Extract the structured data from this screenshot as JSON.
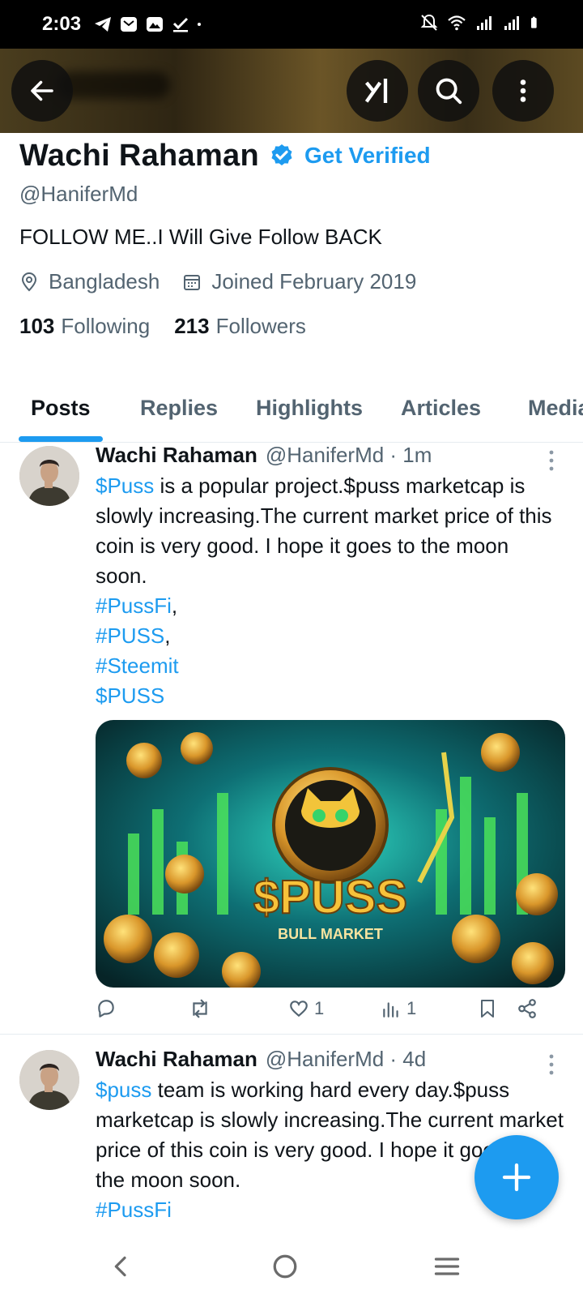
{
  "status_bar": {
    "time": "2:03",
    "left_icons": [
      "telegram-icon",
      "mail-icon",
      "gallery-icon",
      "task-icon",
      "dot-icon"
    ],
    "right_icons": [
      "mute-icon",
      "wifi-icon",
      "signal-icon",
      "signal-icon",
      "battery-icon"
    ]
  },
  "header": {
    "back_icon": "arrow-left-icon",
    "grok_icon": "grok-icon",
    "search_icon": "search-icon",
    "more_icon": "more-vertical-icon"
  },
  "profile": {
    "name": "Wachi Rahaman",
    "get_verified": "Get Verified",
    "handle": "@HaniferMd",
    "bio": "FOLLOW ME..I Will Give Follow BACK",
    "location": "Bangladesh",
    "joined": "Joined February 2019",
    "following_count": "103",
    "following_label": "Following",
    "followers_count": "213",
    "followers_label": "Followers"
  },
  "tabs": [
    {
      "label": "Posts",
      "active": true
    },
    {
      "label": "Replies"
    },
    {
      "label": "Highlights"
    },
    {
      "label": "Articles"
    },
    {
      "label": "Media"
    }
  ],
  "posts": [
    {
      "name": "Wachi Rahaman",
      "handle_time": "@HaniferMd · 1m",
      "cashtag": "$Puss",
      "text": " is a popular project.$puss marketcap is slowly increasing.The current market price of this coin is very good. I hope it goes to the moon soon.",
      "tag1": "#PussFi",
      "tag2": "#PUSS",
      "tag3": "#Steemit",
      "tag4": "$PUSS",
      "media_title": "$PUSS",
      "media_subtitle": "BULL MARKET",
      "likes": "1",
      "views": "1"
    },
    {
      "name": "Wachi Rahaman",
      "handle_time": "@HaniferMd · 4d",
      "cashtag": "$puss",
      "text": " team is working hard every day.$puss marketcap is slowly increasing.The current market price of this coin is very good. I hope it goes to the moon soon.",
      "tag1": "#PussFi"
    }
  ],
  "colors": {
    "accent": "#1d9bf0",
    "text": "#0f1419",
    "secondary": "#536471"
  }
}
